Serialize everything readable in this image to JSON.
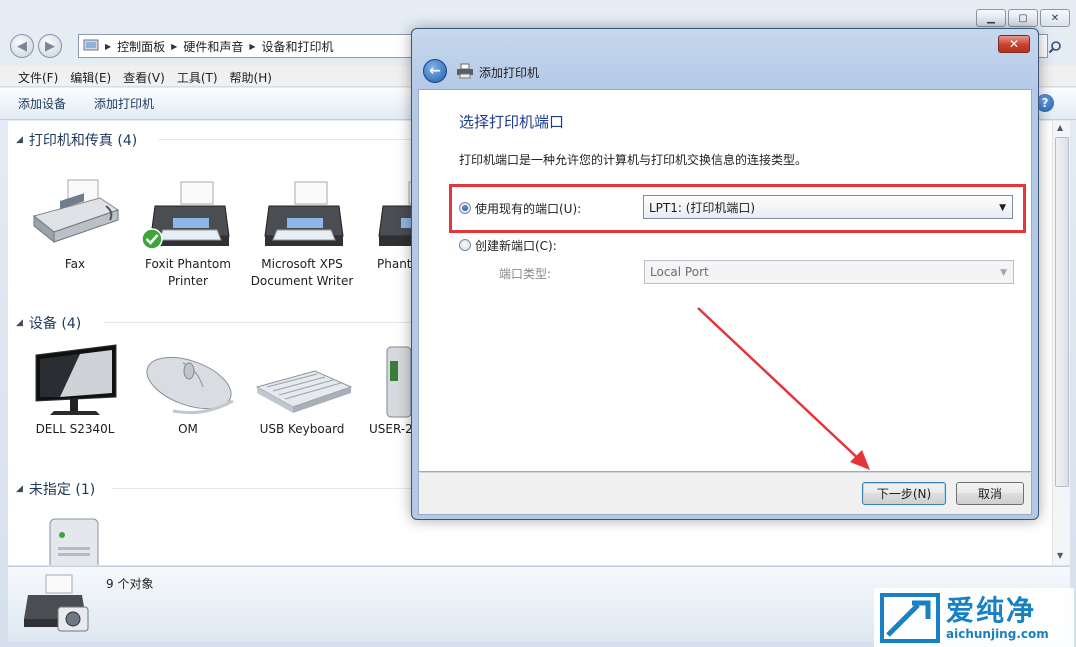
{
  "explorer": {
    "window_buttons": [
      "minimize",
      "maximize",
      "close"
    ],
    "breadcrumb": [
      "控制面板",
      "硬件和声音",
      "设备和打印机"
    ],
    "menu": [
      "文件(F)",
      "编辑(E)",
      "查看(V)",
      "工具(T)",
      "帮助(H)"
    ],
    "toolbar": [
      "添加设备",
      "添加打印机"
    ],
    "groups": {
      "printers": "打印机和传真 (4)",
      "devices": "设备 (4)",
      "unspecified": "未指定 (1)"
    },
    "printers": [
      {
        "label": "Fax",
        "icon": "fax-icon"
      },
      {
        "label": "Foxit Phantom Printer",
        "icon": "printer-icon",
        "default": true
      },
      {
        "label": "Microsoft XPS Document Writer",
        "icon": "printer-icon"
      },
      {
        "label": "Phanto to Ev",
        "icon": "printer-icon"
      }
    ],
    "devices": [
      {
        "label": "DELL S2340L",
        "icon": "monitor-icon"
      },
      {
        "label": "OM",
        "icon": "mouse-icon"
      },
      {
        "label": "USB Keyboard",
        "icon": "keyboard-icon"
      },
      {
        "label": "USER-2",
        "icon": "computer-tower-icon"
      }
    ],
    "status": {
      "count": "9 个对象"
    }
  },
  "dialog": {
    "title": "添加打印机",
    "heading": "选择打印机端口",
    "description": "打印机端口是一种允许您的计算机与打印机交换信息的连接类型。",
    "option_existing": {
      "label": "使用现有的端口(U):",
      "selected": true,
      "value": "LPT1: (打印机端口)"
    },
    "option_new": {
      "label": "创建新端口(C):",
      "selected": false
    },
    "port_type": {
      "label": "端口类型:",
      "value": "Local Port",
      "disabled": true
    },
    "buttons": {
      "next": "下一步(N)",
      "cancel": "取消"
    },
    "highlight_color": "#e3353a"
  },
  "watermark": {
    "brand": "爱纯净",
    "url": "aichunjing.com",
    "color": "#1a80c4"
  }
}
